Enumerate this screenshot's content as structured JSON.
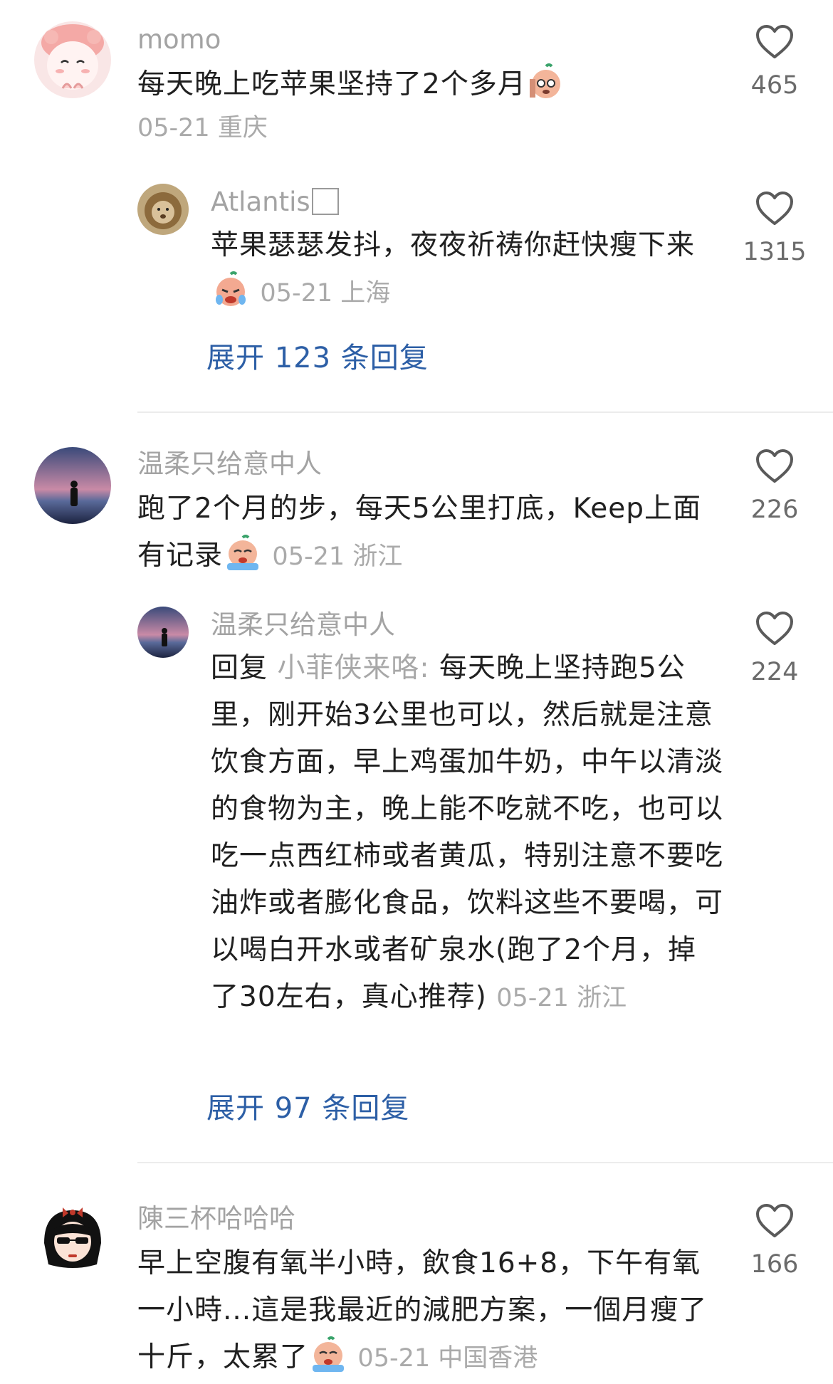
{
  "comments": [
    {
      "username": "momo",
      "text": "每天晚上吃苹果坚持了2个多月",
      "emoji_icon": "confused-fruit-emoji",
      "meta": "05-21 重庆",
      "likes": "465",
      "reply": {
        "username": "Atlantis",
        "text": "苹果瑟瑟发抖，夜夜祈祷你赶快瘦下来",
        "emoji_icon": "crying-fruit-emoji",
        "meta": "05-21 上海",
        "likes": "1315"
      },
      "expand_label": "展开 123 条回复"
    },
    {
      "username": "温柔只给意中人",
      "text": "跑了2个月的步，每天5公里打底，Keep上面有记录",
      "emoji_icon": "sobbing-fruit-emoji",
      "meta": "05-21 浙江",
      "likes": "226",
      "reply": {
        "username": "温柔只给意中人",
        "reply_prefix": "回复",
        "reply_to": "小菲侠来咯:",
        "text": "每天晚上坚持跑5公里，刚开始3公里也可以，然后就是注意饮食方面，早上鸡蛋加牛奶，中午以清淡的食物为主，晚上能不吃就不吃，也可以吃一点西红柿或者黄瓜，特别注意不要吃油炸或者膨化食品，饮料这些不要喝，可以喝白开水或者矿泉水(跑了2个月，掉了30左右，真心推荐)",
        "meta": "05-21 浙江",
        "likes": "224"
      },
      "expand_label": "展开 97 条回复"
    },
    {
      "username": "陳三杯哈哈哈",
      "text": "早上空腹有氧半小時，飲食16+8，下午有氧一小時...這是我最近的減肥方案，一個月瘦了十斤，太累了",
      "emoji_icon": "sobbing-fruit-emoji",
      "meta": "05-21 中国香港",
      "likes": "166"
    }
  ]
}
